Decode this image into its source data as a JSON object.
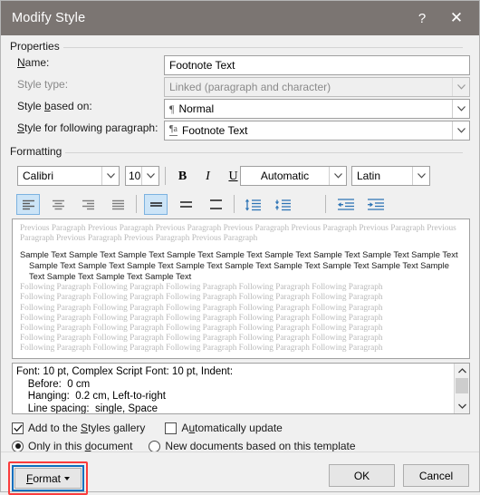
{
  "window": {
    "title": "Modify Style",
    "help_icon": "?",
    "close_icon": "✕"
  },
  "properties": {
    "legend": "Properties",
    "name_label": "Name:",
    "name_value": "Footnote Text",
    "style_type_label": "Style type:",
    "style_type_value": "Linked (paragraph and character)",
    "style_based_label": "Style based on:",
    "style_based_icon": "¶",
    "style_based_value": "Normal",
    "style_following_label": "Style for following paragraph:",
    "style_following_icon": "¶a",
    "style_following_value": "Footnote Text"
  },
  "formatting": {
    "legend": "Formatting",
    "font_family": "Calibri",
    "font_size": "10",
    "bold": "B",
    "italic": "I",
    "underline": "U",
    "font_color": "Automatic",
    "script": "Latin",
    "align_left": "align-left",
    "align_center": "align-center",
    "align_right": "align-right",
    "align_justify": "align-justify",
    "spacing_single": "line-spacing-single",
    "spacing_1_5": "line-spacing-1.5",
    "spacing_double": "line-spacing-double",
    "space_before": "increase-paragraph-spacing",
    "space_after": "decrease-paragraph-spacing",
    "indent_decrease": "decrease-indent",
    "indent_increase": "increase-indent"
  },
  "preview": {
    "previous_paragraph": "Previous Paragraph Previous Paragraph Previous Paragraph Previous Paragraph Previous Paragraph Previous Paragraph Previous Paragraph Previous Paragraph Previous Paragraph Previous Paragraph",
    "sample_text": "Sample Text Sample Text Sample Text Sample Text Sample Text Sample Text Sample Text Sample Text Sample Text Sample Text Sample Text Sample Text Sample Text Sample Text Sample Text Sample Text Sample Text Sample Text Sample Text Sample Text Sample Text",
    "following_paragraph": "Following Paragraph Following Paragraph Following Paragraph Following Paragraph Following Paragraph "
  },
  "description": {
    "text": "Font: 10 pt, Complex Script Font: 10 pt, Indent:\n    Before:  0 cm\n    Hanging:  0.2 cm, Left-to-right\n    Line spacing:  single, Space",
    "scroll_up_icon": "⌃",
    "scroll_down_icon": "⌄"
  },
  "options": {
    "add_to_gallery_label": "Add to the Styles gallery",
    "add_to_gallery_checked": true,
    "auto_update_label": "Automatically update",
    "auto_update_checked": false,
    "only_this_document_label": "Only in this document",
    "only_this_document_selected": true,
    "new_documents_label": "New documents based on this template",
    "new_documents_selected": false
  },
  "footer": {
    "format_label": "Format",
    "ok_label": "OK",
    "cancel_label": "Cancel"
  },
  "colors": {
    "titlebar": "#7b7572",
    "dialog_bg": "#f0f0f0",
    "accent_selected": "#cce4f7",
    "icon_blue": "#2e74b5",
    "highlight_red": "#fa3c3c",
    "focus_blue": "#0a6ebd"
  }
}
